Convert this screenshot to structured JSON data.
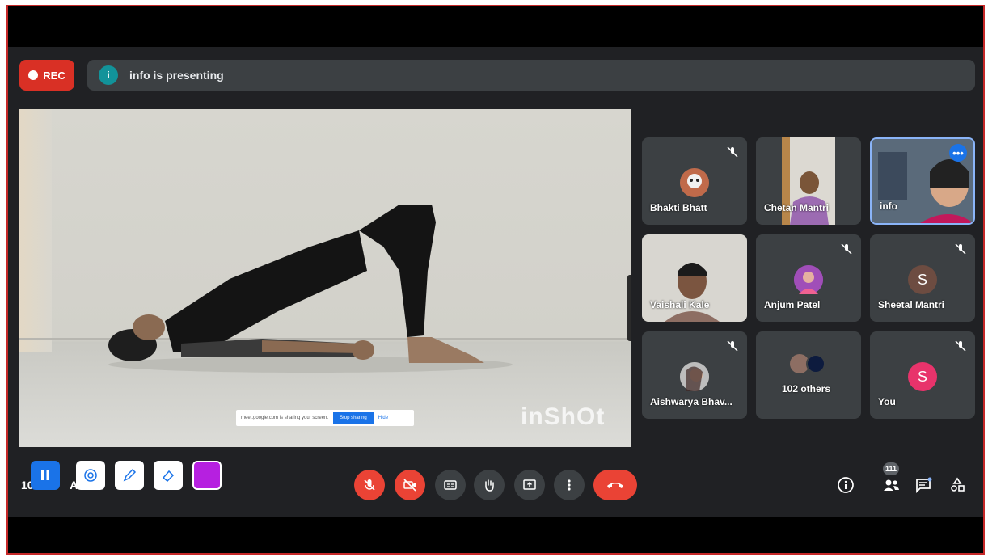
{
  "rec": {
    "label": "REC"
  },
  "presenting": {
    "icon_letter": "i",
    "text": "info is presenting"
  },
  "video": {
    "share_toast": {
      "message": "meet.google.com is sharing your screen.",
      "stop_label": "Stop sharing",
      "hide_label": "Hide"
    },
    "watermark": "inShOt"
  },
  "participants": [
    {
      "name": "Bhakti Bhatt",
      "muted": true,
      "avatar": "",
      "avatar_color": "#5f6368"
    },
    {
      "name": "Chetan Mantri",
      "muted": false,
      "avatar": "",
      "avatar_color": ""
    },
    {
      "name": "info",
      "muted": false,
      "avatar": "",
      "avatar_color": ""
    },
    {
      "name": "Vaishali Kale",
      "muted": false,
      "avatar": "",
      "avatar_color": ""
    },
    {
      "name": "Anjum Patel",
      "muted": true,
      "avatar": "",
      "avatar_color": "#8e44ad"
    },
    {
      "name": "Sheetal Mantri",
      "muted": true,
      "avatar": "S",
      "avatar_color": "#6d4c41"
    },
    {
      "name": "Aishwarya Bhav...",
      "muted": true,
      "avatar": "",
      "avatar_color": "#9e9e9e"
    },
    {
      "name": "102 others",
      "muted": false,
      "avatar": "",
      "avatar_color": ""
    },
    {
      "name": "You",
      "muted": true,
      "avatar": "S",
      "avatar_color": "#e8336b"
    }
  ],
  "more_menu": "•••",
  "clock": "10:",
  "clock_suffix": "AM",
  "people_count": "111",
  "colors": {
    "accent": "#1a73e8",
    "danger": "#ea4335",
    "pen_color": "#b620e0"
  }
}
